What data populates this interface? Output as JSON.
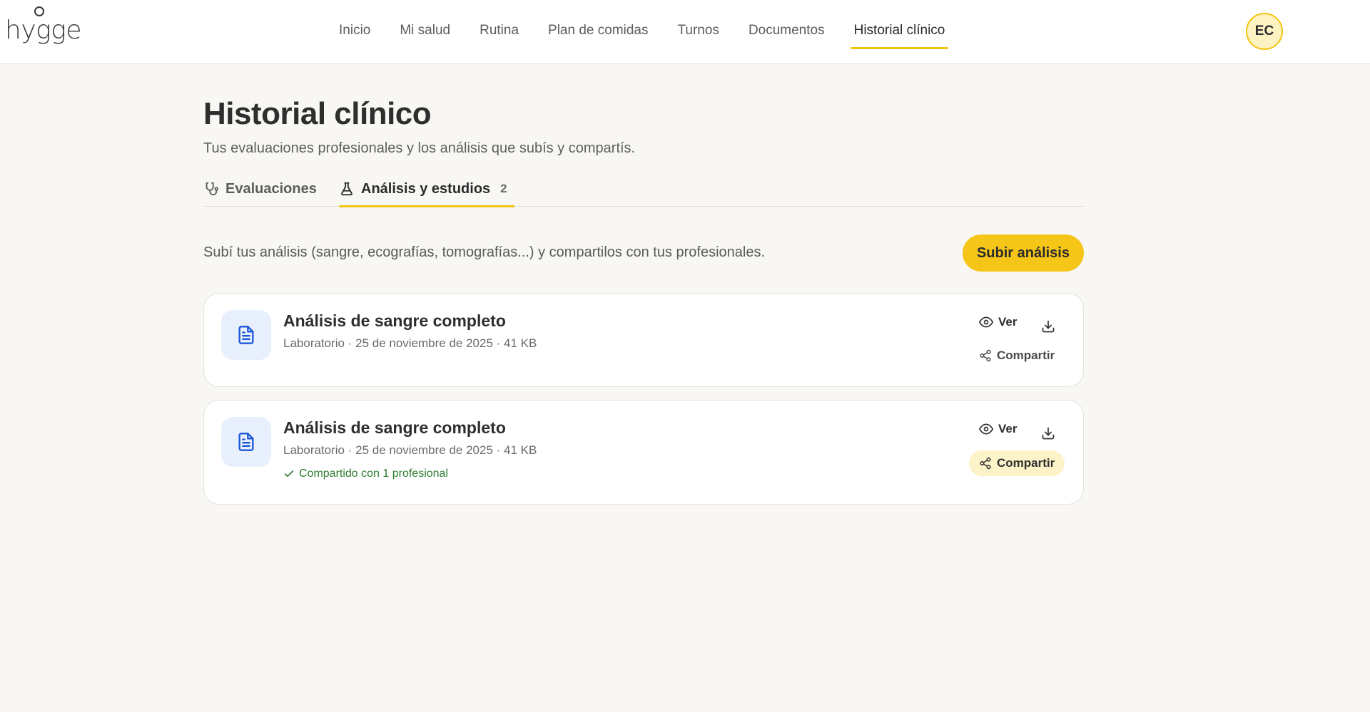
{
  "app": {
    "logo_text": "hygge",
    "avatar_initials": "EC",
    "accent_color": "#f1c40f",
    "brand_icon_color": "#1a56db",
    "success_color": "#2e7d32"
  },
  "nav": {
    "items": [
      {
        "label": "Inicio"
      },
      {
        "label": "Mi salud"
      },
      {
        "label": "Rutina"
      },
      {
        "label": "Plan de comidas"
      },
      {
        "label": "Turnos"
      },
      {
        "label": "Documentos"
      },
      {
        "label": "Historial clínico",
        "active": true
      }
    ]
  },
  "page": {
    "title": "Historial clínico",
    "subtitle": "Tus evaluaciones profesionales y los análisis que subís y compartís."
  },
  "tabs": [
    {
      "label": "Evaluaciones",
      "icon": "stethoscope-icon"
    },
    {
      "label": "Análisis y estudios",
      "icon": "flask-icon",
      "count": "2",
      "active": true
    }
  ],
  "upload": {
    "description": "Subí tus análisis (sangre, ecografías, tomografías...) y compartilos con tus profesionales.",
    "button_label": "Subir análisis"
  },
  "documents": [
    {
      "title": "Análisis de sangre completo",
      "meta": "Laboratorio · 25 de noviembre de 2025 · 41 KB",
      "view_label": "Ver",
      "share_label": "Compartir",
      "icon": "document-icon"
    },
    {
      "title": "Análisis de sangre completo",
      "meta": "Laboratorio · 25 de noviembre de 2025 · 41 KB",
      "shared_text": "Compartido con 1 profesional",
      "view_label": "Ver",
      "share_label": "Compartir",
      "icon": "document-icon"
    }
  ]
}
